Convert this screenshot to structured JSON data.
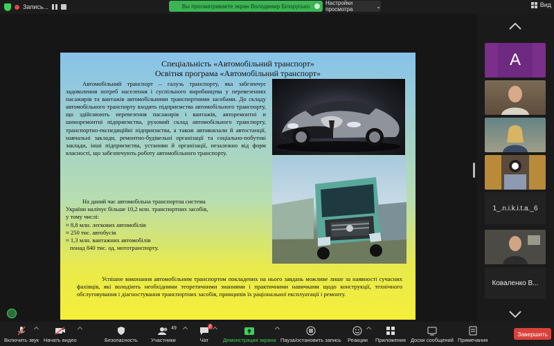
{
  "top_bar": {
    "recording_label": "Запись...",
    "share_banner": "Вы просматриваете экран Володимир Білорусько",
    "view_settings": "Настройки просмотра",
    "view_label": "Вид"
  },
  "slide": {
    "title_line1": "Спеціальність «Автомобільний транспорт»",
    "title_line2": "Освітня програма «Автомобільний транспорт»",
    "paragraph1": "Автомобільний транспорт – галузь транспорту, яка забезпечує задоволення потреб населення і суспільного виробництва у перевезеннях пасажирів та вантажів автомобільними транспортними засобами. До складу автомобільного транспорту входять підприємства автомобільного транспорту, що здійснюють перевезення пасажирів і вантажів, авторемонтні и шиноремонтні підприємства, рухомий склад автомобільного транспорту, транспортно-експедиційні підприємства, а також автовокзали й автостанції, навчальні заклади, ремонтно-будівельні організації та соціально-побутові заклади, інші підприємства, установи й організації, незалежно від форм власності, що забезпечують роботу автомобільного транспорту.",
    "paragraph2_line1": "На даний час автомобільна транспортна система",
    "paragraph2_line2": "України налічує  більше 10,2 млн. транспортних засобів,",
    "paragraph2_line3": "у тому числі:",
    "stat1": "≈ 8,8 млн. легкових автомобілів",
    "stat2": "≈ 250 тис. автобусів",
    "stat3": "≈ 1,3 млн. вантажних автомобілів",
    "stat4": "понад 840 тис. од. мототранспорту.",
    "paragraph3": "Успішне виконання автомобільним транспортом покладених на нього завдань можливе лише за наявності сучасних фахівців, які володіють необхідними теоретичними знаннями і практичними навичками щодо конструкції, технічного обслуговування і діагностування транспортних засобів, принципів їх раціональної експлуатації і ремонту."
  },
  "gallery": {
    "avatar_letter": "A",
    "participant_name_1": "1_.n.i.k.i.t.a._6",
    "participant_name_2": "Коваленко В..."
  },
  "toolbar": {
    "mute": "Включить звук",
    "video": "Начать видео",
    "security": "Безопасность",
    "participants": "Участники",
    "participants_count": "49",
    "chat": "Чат",
    "chat_badge": "2",
    "share": "Демонстрация экрана",
    "record": "Пауза/остановить запись",
    "reactions": "Реакции",
    "apps": "Приложения",
    "whiteboards": "Доски сообщений",
    "notes": "Примечания",
    "end": "Завершить"
  },
  "colors": {
    "share_green": "#3bb554",
    "end_red": "#d8423b",
    "avatar_purple": "#7b2f8a"
  }
}
